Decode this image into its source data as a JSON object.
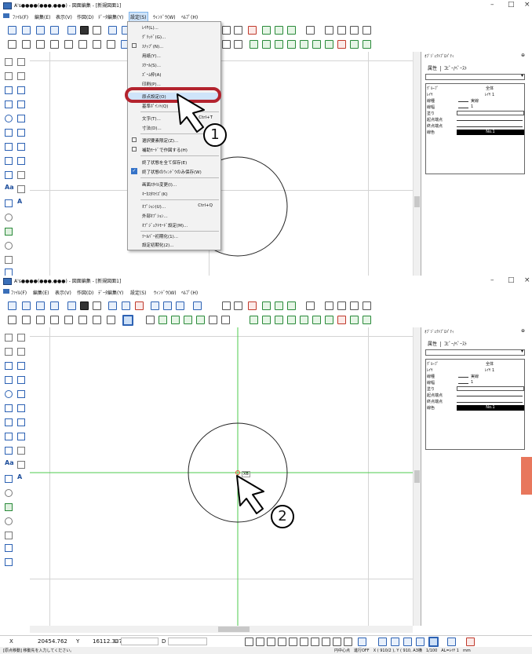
{
  "top": {
    "title": "A's●●●●(●●●,●●●) - 図面編集 - [新規図面1]",
    "win_min": "–",
    "win_max": "□",
    "win_close": "×",
    "menu": [
      "ﾌｧｲﾙ(F)",
      "編集(E)",
      "表示(V)",
      "作図(D)",
      "ﾃﾞｰﾀ編集(Y)",
      "設定(S)",
      "ｳｨﾝﾄﾞｳ(W)",
      "ﾍﾙﾌﾟ(H)"
    ],
    "dropdown": [
      {
        "label": "ﾚｲﾔ(L)..."
      },
      {
        "label": "ｸﾞﾘｯﾄﾞ(G)..."
      },
      {
        "label": "ｽﾅｯﾌﾟ(N)..."
      },
      {
        "label": "用紙(Y)..."
      },
      {
        "label": "ｽｹｰﾙ(S)..."
      },
      {
        "label": "ｽﾞｰﾑ枠(A)"
      },
      {
        "label": "印刷(P)..."
      },
      {
        "label": "原点設定(O)"
      },
      {
        "label": "基準ﾎﾟｲﾝﾄ(Q)"
      },
      {
        "label": "文字(T)...",
        "shortcut": "Ctrl+T"
      },
      {
        "label": "寸法(D)..."
      },
      {
        "label": "選択要素限定(Z)..."
      },
      {
        "label": "補助ﾓｰﾄﾞで作図する(H)"
      },
      {
        "label": "終了状態を全て保存(E)"
      },
      {
        "label": "終了状態のｳｨﾝﾄﾞｳのみ保存(W)"
      },
      {
        "label": "画面ｽﾀｲﾙ変更(I)..."
      },
      {
        "label": "ｷｰｶｽﾀﾏｲｽﾞ(K)"
      },
      {
        "label": "ｵﾌﾟｼｮﾝ(U)...",
        "shortcut": "Ctrl+Q"
      },
      {
        "label": "外部ｵﾌﾟｼｮﾝ..."
      },
      {
        "label": "ｵﾌﾟｼﾞｪｸﾄﾓｰﾄﾞ設定(M)..."
      },
      {
        "label": "ﾂｰﾙﾊﾞｰ初期化(1)..."
      },
      {
        "label": "設定初期化(2)..."
      }
    ],
    "callout_number": "1"
  },
  "panel": {
    "title": "ｵﾌﾞｼﾞｪｸﾄﾌﾟﾛﾊﾟﾃｨ",
    "pin": "⊕",
    "tab_attr": "属性",
    "tab_copy": "ｺﾋﾟｰ/ﾍﾟｰｽﾄ",
    "combo_arrow": "▾",
    "rows": [
      {
        "key": "ｸﾞﾙｰﾌﾟ",
        "value": "全体"
      },
      {
        "key": "ﾚｲﾔ",
        "value": "ﾚｲﾔ 1"
      },
      {
        "key": "線種",
        "value": "実線"
      },
      {
        "key": "線幅",
        "value": "1"
      },
      {
        "key": "塗り",
        "value": ""
      },
      {
        "key": "起点端点",
        "value": ""
      },
      {
        "key": "終点端点",
        "value": ""
      },
      {
        "key": "線色",
        "value": "No.1"
      }
    ]
  },
  "bottom": {
    "title": "A's●●●●(●●●,●●●) - 図面編集 - [新規図面1]",
    "menu": [
      "ﾌｧｲﾙ(F)",
      "編集(E)",
      "表示(V)",
      "作図(D)",
      "ﾃﾞｰﾀ編集(Y)",
      "設定(S)",
      "ｳｨﾝﾄﾞｳ(W)",
      "ﾍﾙﾌﾟ(H)"
    ],
    "callout_number": "2",
    "origin_tag": "XB"
  },
  "status": {
    "x_label": "X",
    "x_value": "20454.762",
    "y_label": "Y",
    "y_value": "16112.337",
    "l_label": "L",
    "d_label": "D",
    "message": "[原点移動] 移動先を入力してください。",
    "info": "円中心点　進行OFF　X ( 910/2 ), Y ( 910, A3横　1/100　AL=ﾚｲﾔ 1　mm"
  }
}
